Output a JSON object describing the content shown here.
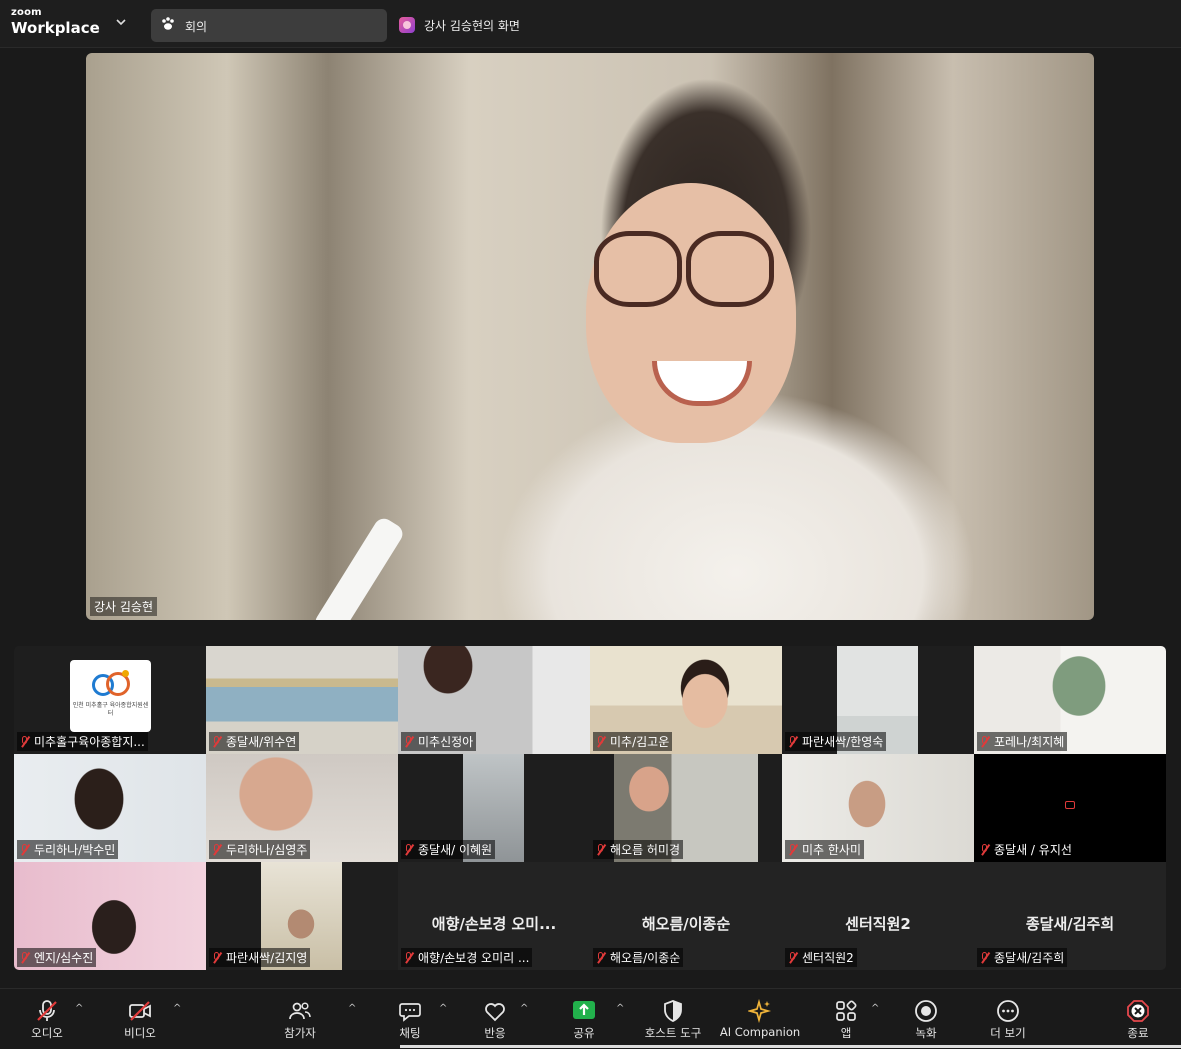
{
  "app": {
    "logo_top": "zoom",
    "logo_bottom": "Workplace"
  },
  "tabs": {
    "meeting_label": "회의",
    "share_label": "강사 김승현의 화면"
  },
  "speaker": {
    "name": "강사 김승현"
  },
  "gallery": {
    "tiles": [
      {
        "name": "미추홀구육아종합지...",
        "logo_text": "인천 미추홀구\n육아종합지원센터"
      },
      {
        "name": "종달새/위수연"
      },
      {
        "name": "미추신정아"
      },
      {
        "name": "미추/김고운"
      },
      {
        "name": "파란새싹/한영숙"
      },
      {
        "name": "포레나/최지혜"
      },
      {
        "name": "두리하나/박수민"
      },
      {
        "name": "두리하나/심영주"
      },
      {
        "name": "종달새/ 이혜원"
      },
      {
        "name": "해오름 허미경"
      },
      {
        "name": "미추 한사미"
      },
      {
        "name": "종달새 / 유지선"
      },
      {
        "name": "엔지/심수진"
      },
      {
        "name": "파란새싹/김지영"
      },
      {
        "name": "애향/손보경 오미리 ...",
        "big": "애향/손보경 오미..."
      },
      {
        "name": "해오름/이종순",
        "big": "해오름/이종순"
      },
      {
        "name": "센터직원2",
        "big": "센터직원2"
      },
      {
        "name": "종달새/김주희",
        "big": "종달새/김주희"
      }
    ]
  },
  "toolbar": {
    "audio": "오디오",
    "video": "비디오",
    "participants": "참가자",
    "chat": "채팅",
    "reactions": "반응",
    "share": "공유",
    "host_tools": "호스트 도구",
    "ai_companion": "AI Companion",
    "apps": "앱",
    "record": "녹화",
    "more": "더 보기",
    "end": "종료"
  },
  "colors": {
    "share_green": "#22b14c",
    "mute_red": "#e03a3a",
    "end_red": "#e5484d"
  }
}
